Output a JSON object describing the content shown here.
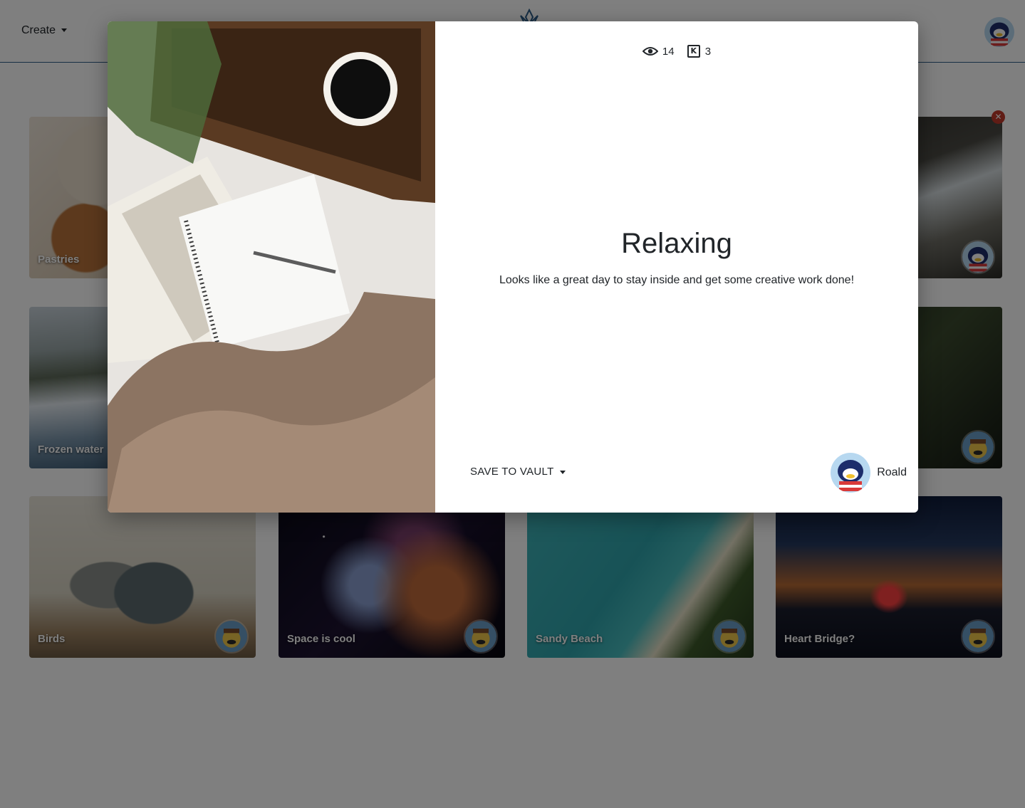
{
  "navbar": {
    "create_label": "Create",
    "logo_icon": "lotus-logo-icon",
    "user_avatar_icon": "penguin-avatar-icon"
  },
  "cards": [
    {
      "title": "Pastries"
    },
    {
      "title": ""
    },
    {
      "title": "Frozen water"
    },
    {
      "title": ""
    },
    {
      "title": "Birds"
    },
    {
      "title": "Space is cool"
    },
    {
      "title": "Sandy Beach"
    },
    {
      "title": "Heart Bridge?"
    }
  ],
  "modal": {
    "views": "14",
    "keeps": "3",
    "keep_icon_letter": "K",
    "title": "Relaxing",
    "description": "Looks like a great day to stay inside and get some creative work done!",
    "save_label": "SAVE TO VAULT",
    "author_name": "Roald"
  },
  "colors": {
    "navbar_border": "#2c5d88",
    "overlay": "rgba(0,0,0,0.5)",
    "delete": "#c0392b"
  }
}
